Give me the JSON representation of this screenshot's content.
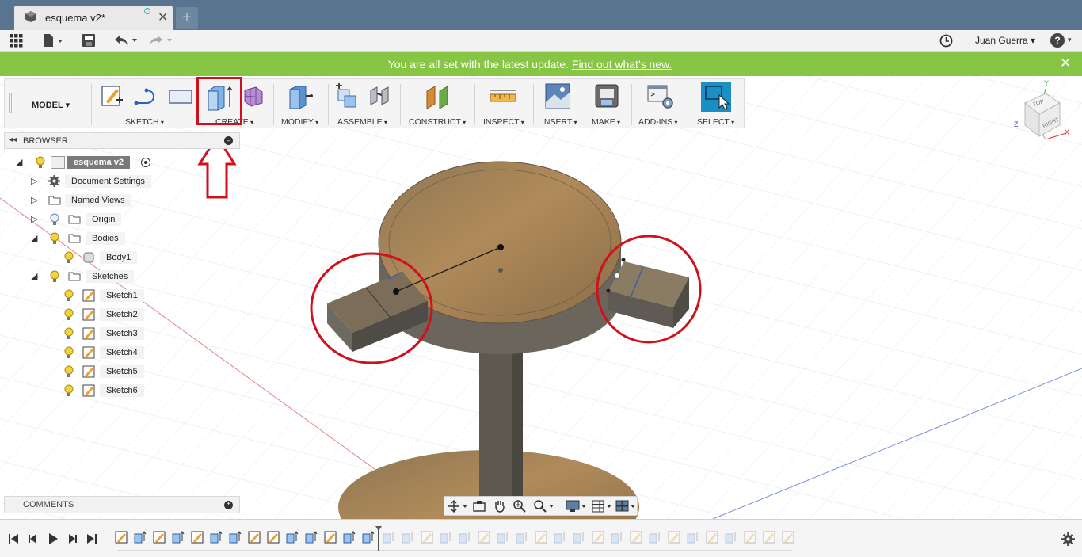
{
  "tab": {
    "title": "esquema v2*",
    "close": "✕",
    "new": "+"
  },
  "quickbar": {
    "user_name": "Juan Guerra ▾",
    "help": "?"
  },
  "banner": {
    "message": "You are all set with the latest update.",
    "link": "Find out what's new.",
    "close": "✕"
  },
  "toolbar": {
    "workspace": "MODEL",
    "groups": [
      "SKETCH",
      "CREATE",
      "MODIFY",
      "ASSEMBLE",
      "CONSTRUCT",
      "INSPECT",
      "INSERT",
      "MAKE",
      "ADD-INS",
      "SELECT"
    ]
  },
  "browser": {
    "title": "BROWSER",
    "root": "esquema v2",
    "items": {
      "document_settings": "Document Settings",
      "named_views": "Named Views",
      "origin": "Origin",
      "bodies": "Bodies",
      "body1": "Body1",
      "sketches": "Sketches"
    },
    "sketches": [
      "Sketch1",
      "Sketch2",
      "Sketch3",
      "Sketch4",
      "Sketch5",
      "Sketch6"
    ]
  },
  "comments": {
    "title": "COMMENTS"
  },
  "viewcube": {
    "top": "TOP",
    "right": "RIGHT",
    "x": "X",
    "y": "Y",
    "z": "Z"
  },
  "colors": {
    "banner": "#87c544",
    "tabbar": "#59748f",
    "annotation": "#d0111b",
    "select_active": "#1a8fc6"
  }
}
